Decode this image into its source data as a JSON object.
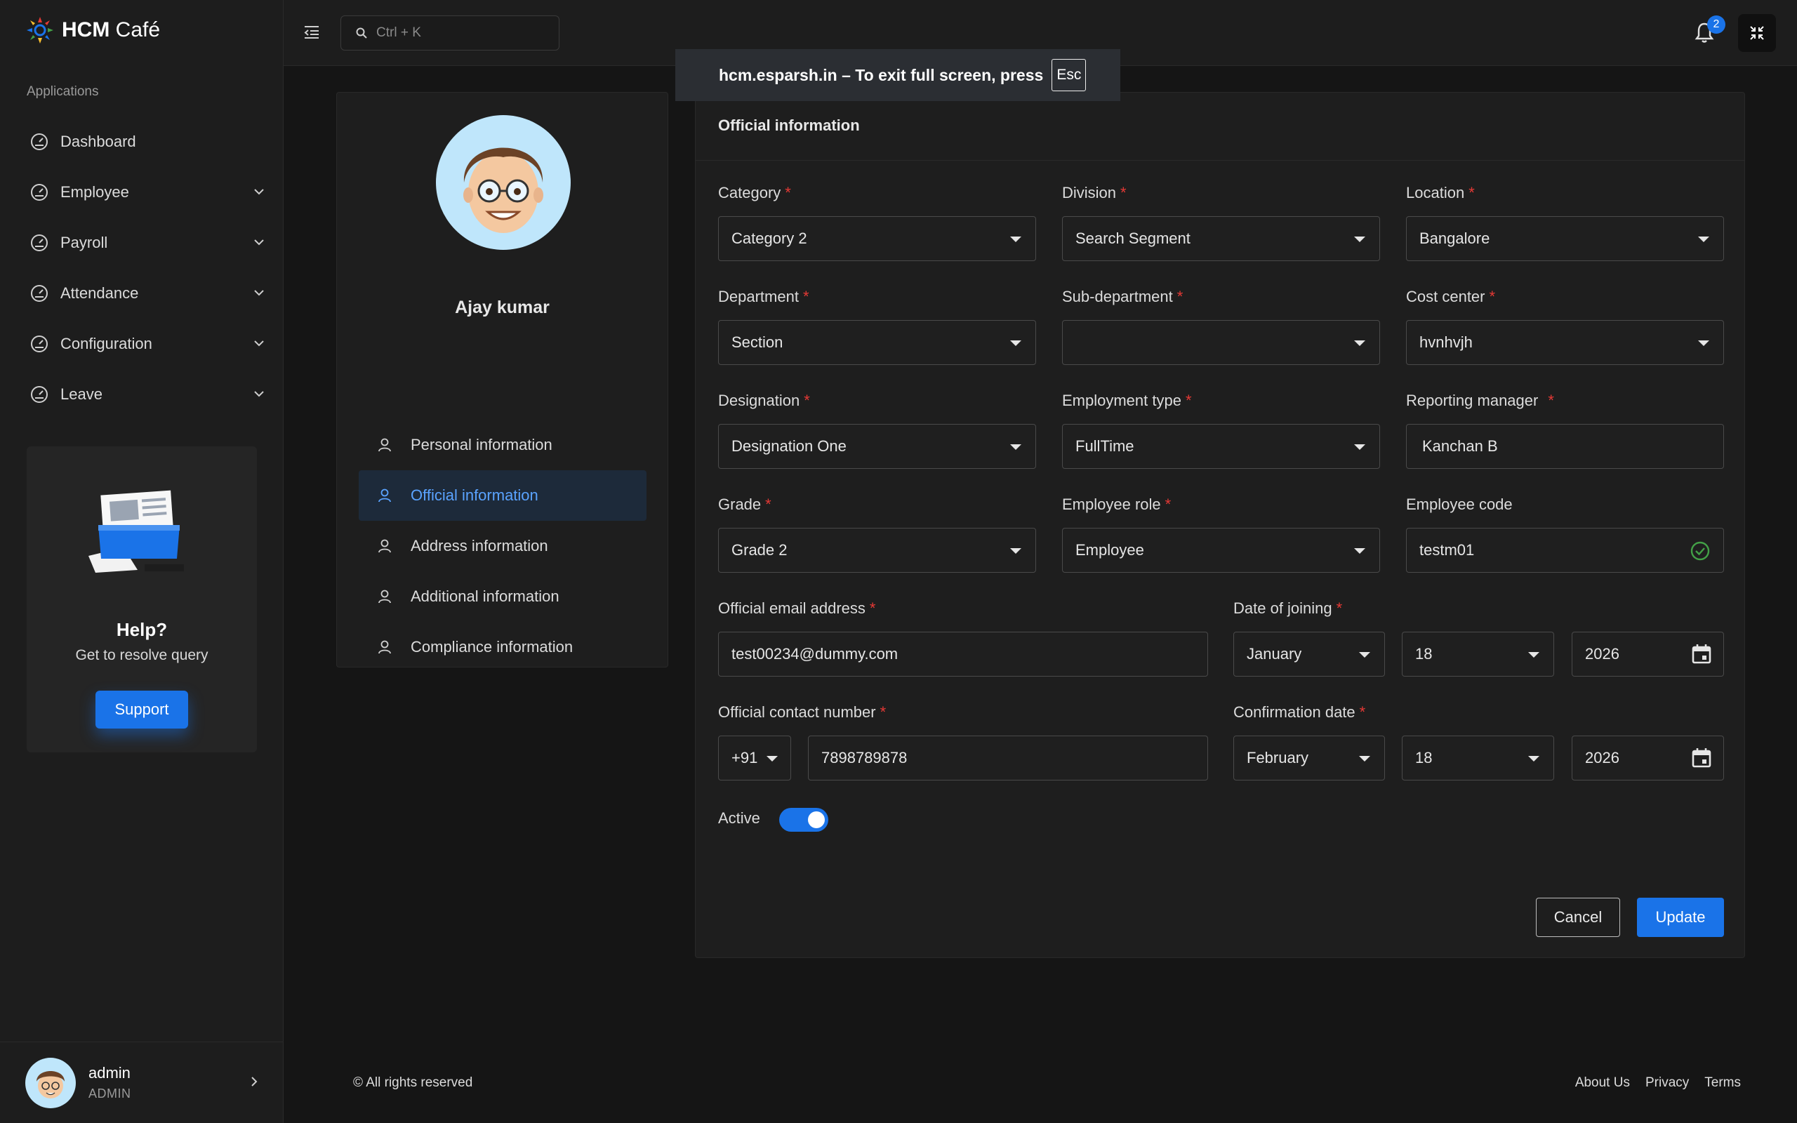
{
  "app": {
    "brand_bold": "HCM",
    "brand_light": "Café"
  },
  "sidebar": {
    "section_label": "Applications",
    "items": [
      {
        "label": "Dashboard",
        "icon": "dashboard-icon",
        "expandable": false
      },
      {
        "label": "Employee",
        "icon": "dashboard-icon",
        "expandable": true
      },
      {
        "label": "Payroll",
        "icon": "dashboard-icon",
        "expandable": true
      },
      {
        "label": "Attendance",
        "icon": "dashboard-icon",
        "expandable": true
      },
      {
        "label": "Configuration",
        "icon": "dashboard-icon",
        "expandable": true
      },
      {
        "label": "Leave",
        "icon": "dashboard-icon",
        "expandable": true
      }
    ],
    "help": {
      "title": "Help?",
      "subtitle": "Get to resolve query",
      "button": "Support"
    },
    "user": {
      "name": "admin",
      "role": "ADMIN"
    }
  },
  "topbar": {
    "search_placeholder": "Ctrl + K",
    "notification_count": "2"
  },
  "toast": {
    "text": "hcm.esparsh.in – To exit full screen, press",
    "key": "Esc"
  },
  "profile": {
    "name": "Ajay kumar",
    "menu": [
      {
        "label": "Personal information",
        "active": false
      },
      {
        "label": "Official information",
        "active": true
      },
      {
        "label": "Address information",
        "active": false
      },
      {
        "label": "Additional information",
        "active": false
      },
      {
        "label": "Compliance information",
        "active": false
      }
    ]
  },
  "form": {
    "title": "Official information",
    "category": {
      "label": "Category",
      "value": "Category 2"
    },
    "division": {
      "label": "Division",
      "value": "Search Segment"
    },
    "location": {
      "label": "Location",
      "value": "Bangalore"
    },
    "department": {
      "label": "Department",
      "value": "Section"
    },
    "sub_department": {
      "label": "Sub-department",
      "value": ""
    },
    "cost_center": {
      "label": "Cost center",
      "value": "hvnhvjh"
    },
    "designation": {
      "label": "Designation",
      "value": "Designation One"
    },
    "employment_type": {
      "label": "Employment type",
      "value": "FullTime"
    },
    "reporting_manager": {
      "label": "Reporting manager",
      "value": "Kanchan B"
    },
    "grade": {
      "label": "Grade",
      "value": "Grade 2"
    },
    "employee_role": {
      "label": "Employee role",
      "value": "Employee"
    },
    "employee_code": {
      "label": "Employee code",
      "value": "testm01"
    },
    "official_email": {
      "label": "Official email address",
      "value": "test00234@dummy.com"
    },
    "date_of_joining": {
      "label": "Date of joining",
      "month": "January",
      "day": "18",
      "year": "2026"
    },
    "official_contact": {
      "label": "Official contact number",
      "code": "+91",
      "number": "7898789878"
    },
    "confirmation_date": {
      "label": "Confirmation date",
      "month": "February",
      "day": "18",
      "year": "2026"
    },
    "active": {
      "label": "Active",
      "on": true
    },
    "cancel": "Cancel",
    "update": "Update"
  },
  "footer": {
    "copyright": "© All rights reserved",
    "links": [
      "About Us",
      "Privacy",
      "Terms"
    ]
  },
  "colors": {
    "accent": "#1a73e8",
    "required": "#e53935",
    "success": "#43a047"
  }
}
